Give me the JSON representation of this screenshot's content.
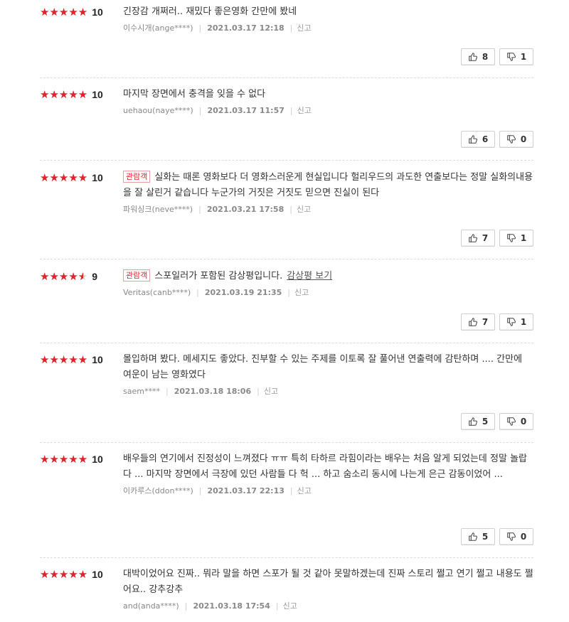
{
  "reviews": [
    {
      "score": 10,
      "badge": "",
      "text": "긴장감 개쩌러.. 재밌다 좋은영화 간만에 봤네",
      "spoiler_link": "",
      "user": "이수시개(ange****)",
      "date": "2021.03.17 12:18",
      "report": "신고",
      "likes": 8,
      "dislikes": 1
    },
    {
      "score": 10,
      "badge": "",
      "text": "마지막 장면에서 충격을 잊을 수 없다",
      "spoiler_link": "",
      "user": "uehaou(naye****)",
      "date": "2021.03.17 11:57",
      "report": "신고",
      "likes": 6,
      "dislikes": 0
    },
    {
      "score": 10,
      "badge": "관람객",
      "text": "실화는 때론 영화보다 더 영화스러운게 현실입니다 헐리우드의 과도한 연출보다는 정말 실화의내용을 잘 살린거 같습니다 누군가의 거짓은 거짓도 믿으면 진실이 된다",
      "spoiler_link": "",
      "user": "파워싱크(neve****)",
      "date": "2021.03.21 17:58",
      "report": "신고",
      "likes": 7,
      "dislikes": 1
    },
    {
      "score": 9,
      "badge": "관람객",
      "text": "스포일러가 포함된 감상평입니다.",
      "spoiler_link": "감상평 보기",
      "user": "Veritas(canb****)",
      "date": "2021.03.19 21:35",
      "report": "신고",
      "likes": 7,
      "dislikes": 1
    },
    {
      "score": 10,
      "badge": "",
      "text": "몰입하며 봤다. 메세지도 좋았다. 진부할 수 있는 주제를 이토록 잘 풀어낸 연출력에 감탄하며 .... 간만에 여운이 남는 영화였다",
      "spoiler_link": "",
      "user": "saem****",
      "date": "2021.03.18 18:06",
      "report": "신고",
      "likes": 5,
      "dislikes": 0
    },
    {
      "score": 10,
      "badge": "",
      "text": "배우들의 연기에서 진정성이 느껴졌다 ㅠㅠ 특히 타하르 라힘이라는 배우는 처음 알게 되었는데 정말 놀랍다 ... 마지막 장면에서 극장에 있던 사람들 다 헉 ... 하고 숨소리 동시에 나는게 은근 감동이었어 ...",
      "spoiler_link": "",
      "user": "이카루스(ddon****)",
      "date": "2021.03.17 22:13",
      "report": "신고",
      "likes": 5,
      "dislikes": 0
    },
    {
      "score": 10,
      "badge": "",
      "text": "대박이었어요 진짜.. 뭐라 말을 하면 스포가 될 것 같아 못말하겠는데 진짜 스토리 쩔고 연기 쩔고 내용도 쩔어요.. 강추강추",
      "spoiler_link": "",
      "user": "and(anda****)",
      "date": "2021.03.18 17:54",
      "report": "신고",
      "likes": null,
      "dislikes": null
    }
  ],
  "colors": {
    "star_on": "#e0232b",
    "star_off": "#d3d3d3",
    "badge": "#e0232b"
  },
  "icons": {
    "like": "thumbs-up-icon",
    "dislike": "thumbs-down-icon"
  }
}
